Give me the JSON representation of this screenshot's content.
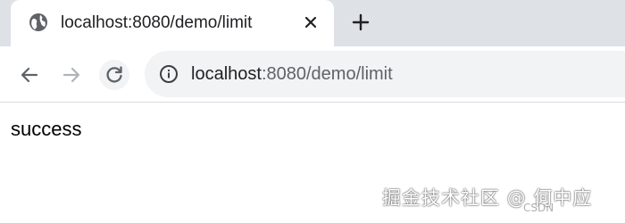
{
  "tab": {
    "title": "localhost:8080/demo/limit",
    "favicon": "globe-icon",
    "close_icon": "close-icon"
  },
  "new_tab_icon": "plus-icon",
  "toolbar": {
    "back_icon": "arrow-left-icon",
    "forward_icon": "arrow-right-icon",
    "reload_icon": "reload-icon",
    "info_icon": "info-icon",
    "url_host": "localhost",
    "url_rest": ":8080/demo/limit"
  },
  "page": {
    "text": "success"
  },
  "watermark": {
    "text": "掘金技术社区 @ 何中应",
    "sub": "CSDN"
  },
  "colors": {
    "tabstrip_bg": "#dee1e6",
    "omnibox_bg": "#f1f3f4",
    "icon_dark": "#5f6368",
    "icon_disabled": "#b0b3b8"
  }
}
